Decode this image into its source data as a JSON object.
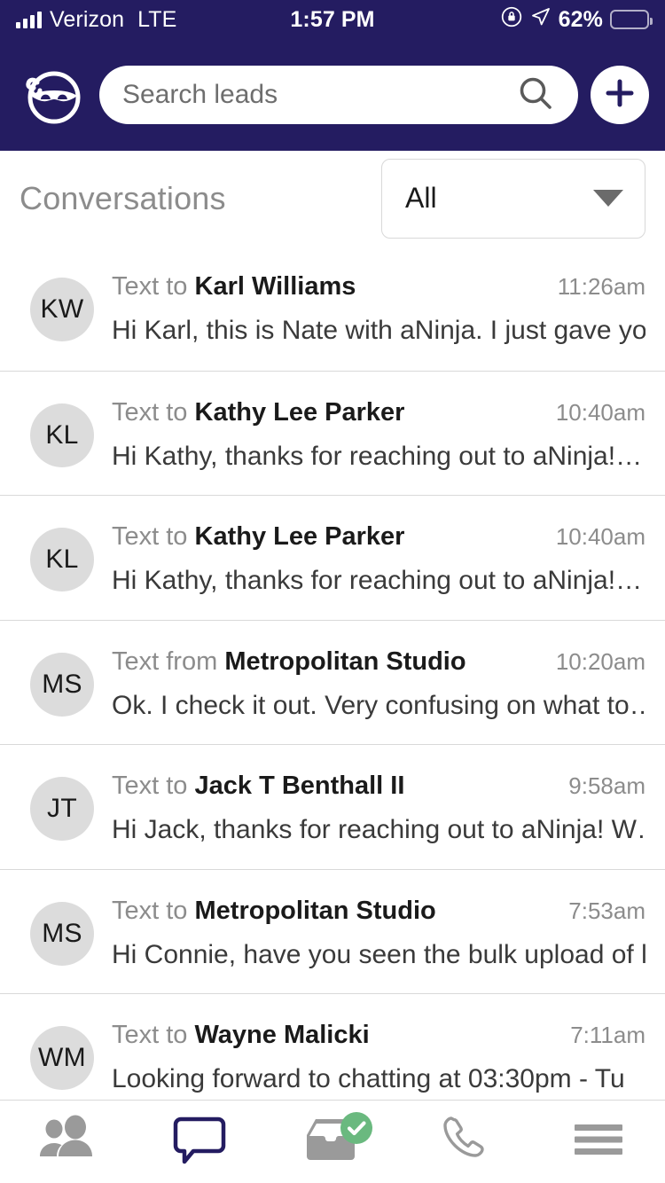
{
  "status_bar": {
    "carrier": "Verizon",
    "network": "LTE",
    "time": "1:57 PM",
    "battery_percent": "62%",
    "icons": [
      "signal-bars-icon",
      "rotation-lock-icon",
      "location-arrow-icon",
      "battery-icon"
    ]
  },
  "header": {
    "logo": "ninja-logo",
    "search": {
      "placeholder": "Search leads",
      "value": ""
    },
    "add_button": "add-icon"
  },
  "page": {
    "title": "Conversations",
    "filter": {
      "selected": "All",
      "options": [
        "All"
      ]
    }
  },
  "conversations": [
    {
      "initials": "KW",
      "direction": "Text to",
      "name": "Karl Williams",
      "time": "11:26am",
      "preview": "Hi Karl, this is Nate with aNinja. I just gave yo…"
    },
    {
      "initials": "KL",
      "direction": "Text to",
      "name": "Kathy Lee Parker",
      "time": "10:40am",
      "preview": "Hi Kathy, thanks for reaching out to aNinja!…"
    },
    {
      "initials": "KL",
      "direction": "Text to",
      "name": "Kathy Lee Parker",
      "time": "10:40am",
      "preview": "Hi Kathy, thanks for reaching out to aNinja!…"
    },
    {
      "initials": "MS",
      "direction": "Text from",
      "name": "Metropolitan Studio",
      "time": "10:20am",
      "preview": "Ok. I check it out. Very confusing on what to…"
    },
    {
      "initials": "JT",
      "direction": "Text to",
      "name": "Jack T Benthall II",
      "time": "9:58am",
      "preview": "Hi Jack, thanks for reaching out to aNinja! W…"
    },
    {
      "initials": "MS",
      "direction": "Text to",
      "name": "Metropolitan Studio",
      "time": "7:53am",
      "preview": "Hi Connie, have you seen the bulk upload of l…"
    },
    {
      "initials": "WM",
      "direction": "Text to",
      "name": "Wayne Malicki",
      "time": "7:11am",
      "preview": "Looking forward to chatting at 03:30pm - Tu"
    }
  ],
  "tabbar": {
    "items": [
      {
        "name": "contacts-icon",
        "label": "Contacts",
        "active": false
      },
      {
        "name": "messages-icon",
        "label": "Messages",
        "active": true
      },
      {
        "name": "inbox-icon",
        "label": "Inbox",
        "active": false,
        "badge": "check"
      },
      {
        "name": "phone-icon",
        "label": "Calls",
        "active": false
      },
      {
        "name": "menu-icon",
        "label": "Menu",
        "active": false
      }
    ]
  },
  "colors": {
    "brand_navy": "#241c61",
    "avatar_gray": "#dcdcdc",
    "badge_green": "#6ab97f",
    "battery_yellow": "#f5d04e"
  }
}
